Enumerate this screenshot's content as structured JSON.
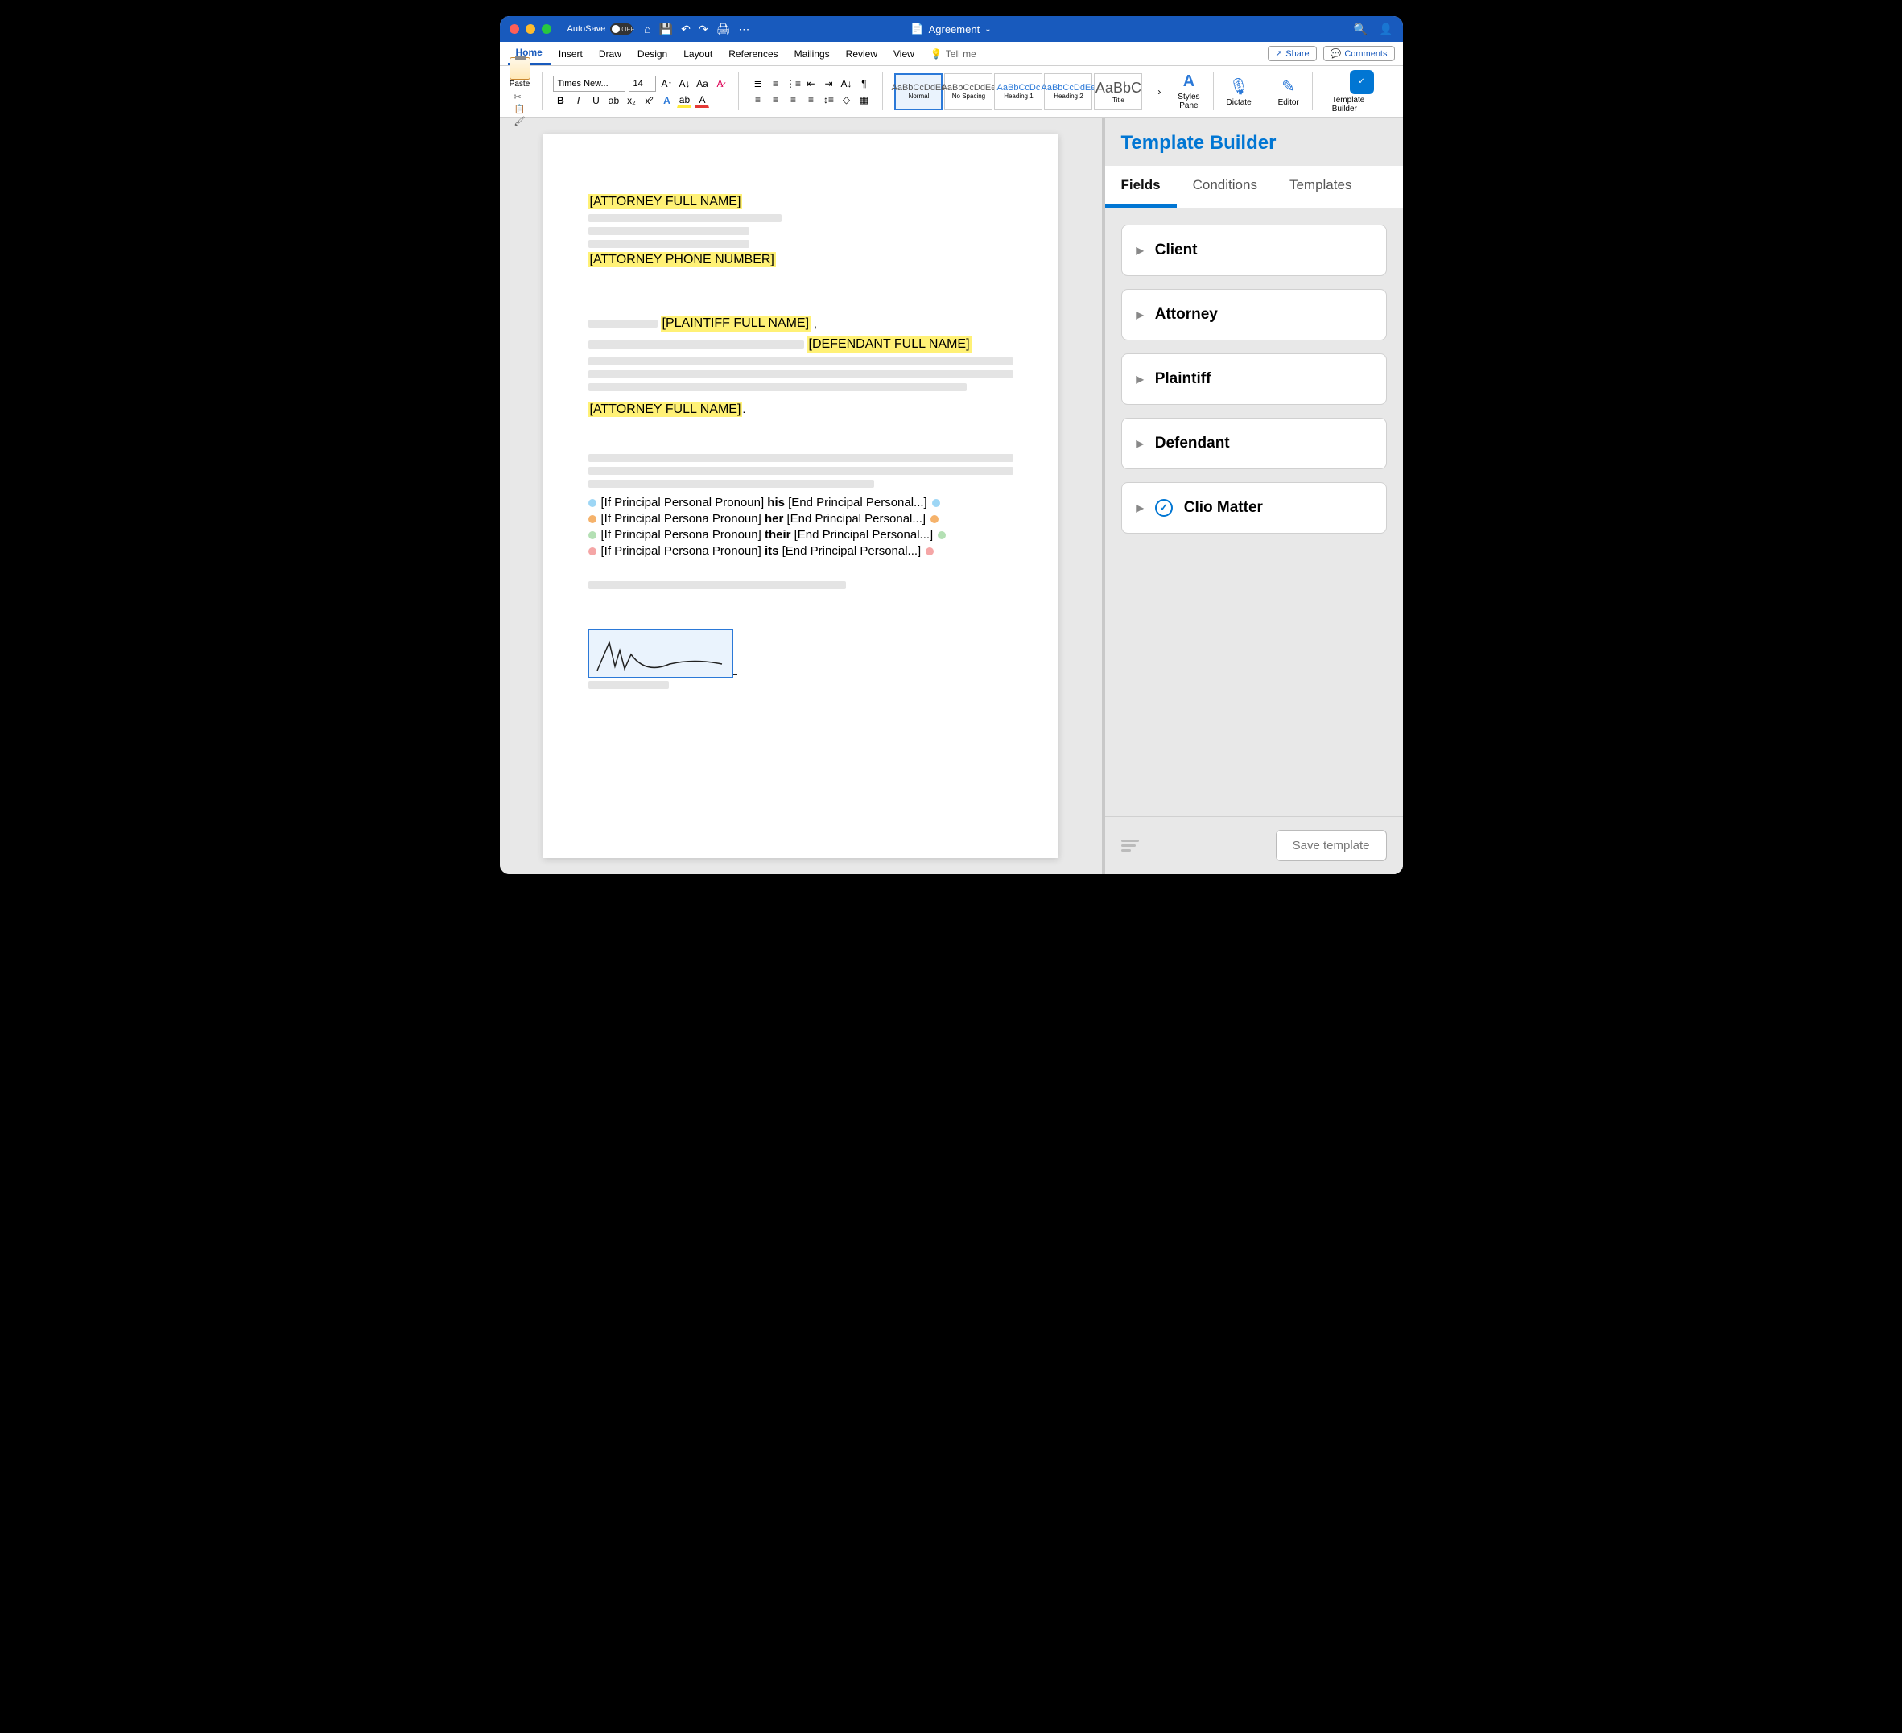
{
  "titlebar": {
    "autosave": "AutoSave",
    "autosave_state": "OFF",
    "doc_title": "Agreement"
  },
  "tabs": {
    "items": [
      "Home",
      "Insert",
      "Draw",
      "Design",
      "Layout",
      "References",
      "Mailings",
      "Review",
      "View"
    ],
    "tellme": "Tell me",
    "share": "Share",
    "comments": "Comments"
  },
  "ribbon": {
    "paste": "Paste",
    "font_name": "Times New...",
    "font_size": "14",
    "styles": [
      {
        "sample": "AaBbCcDdEe",
        "label": "Normal",
        "sel": true,
        "cls": ""
      },
      {
        "sample": "AaBbCcDdEe",
        "label": "No Spacing",
        "sel": false,
        "cls": ""
      },
      {
        "sample": "AaBbCcDc",
        "label": "Heading 1",
        "sel": false,
        "cls": "blue"
      },
      {
        "sample": "AaBbCcDdEe",
        "label": "Heading 2",
        "sel": false,
        "cls": "blue"
      },
      {
        "sample": "AaBbC",
        "label": "Title",
        "sel": false,
        "cls": "big"
      }
    ],
    "styles_pane": "Styles\nPane",
    "dictate": "Dictate",
    "editor": "Editor",
    "template_builder": "Template Builder"
  },
  "doc": {
    "f1": "[ATTORNEY FULL NAME]",
    "f2": "[ATTORNEY PHONE NUMBER]",
    "f3": "[PLAINTIFF FULL NAME]",
    "f3s": ",",
    "f4": "[DEFENDANT FULL NAME]",
    "f5": "[ATTORNEY FULL NAME]",
    "f5s": ".",
    "pronouns": [
      {
        "pre": "[If Principal Personal Pronoun] ",
        "bold": "his",
        "post": " [End Principal Personal...]",
        "c": "#9dd6f5"
      },
      {
        "pre": "[If Principal Persona Pronoun] ",
        "bold": "her",
        "post": " [End Principal Personal...]",
        "c": "#f5b26b"
      },
      {
        "pre": "[If Principal Persona Pronoun] ",
        "bold": "their",
        "post": " [End Principal Personal...]",
        "c": "#b4e0b4"
      },
      {
        "pre": "[If Principal Persona Pronoun] ",
        "bold": "its",
        "post": " [End Principal Personal...]",
        "c": "#f5a6a6"
      }
    ]
  },
  "panel": {
    "title": "Template Builder",
    "tabs": [
      "Fields",
      "Conditions",
      "Templates"
    ],
    "groups": [
      {
        "label": "Client",
        "icon": false
      },
      {
        "label": "Attorney",
        "icon": false
      },
      {
        "label": "Plaintiff",
        "icon": false
      },
      {
        "label": "Defendant",
        "icon": false
      },
      {
        "label": "Clio Matter",
        "icon": true
      }
    ],
    "save": "Save template"
  }
}
